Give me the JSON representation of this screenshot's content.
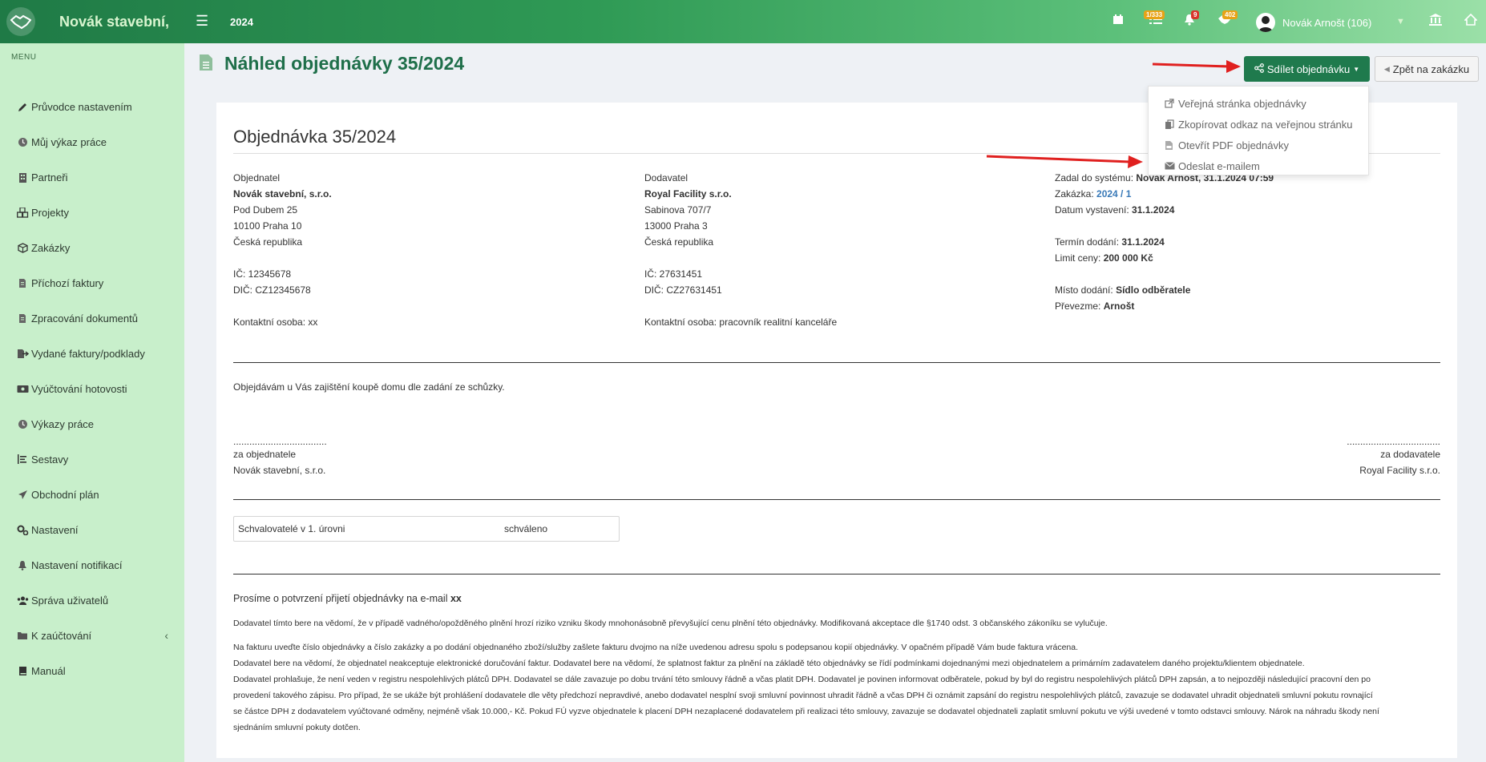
{
  "header": {
    "brand": "Novák stavební,",
    "year": "2024",
    "badges": {
      "tasks": "1/333",
      "notifications": "9",
      "messages": "402"
    },
    "user": "Novák Arnošt (106)"
  },
  "sidebar": {
    "title": "MENU",
    "items": [
      {
        "label": "Průvodce nastavením",
        "icon": "pencil-icon"
      },
      {
        "label": "Můj výkaz práce",
        "icon": "clock-icon"
      },
      {
        "label": "Partneři",
        "icon": "building-icon"
      },
      {
        "label": "Projekty",
        "icon": "cubes-icon"
      },
      {
        "label": "Zakázky",
        "icon": "cube-icon"
      },
      {
        "label": "Příchozí faktury",
        "icon": "file-icon"
      },
      {
        "label": "Zpracování dokumentů",
        "icon": "file-icon"
      },
      {
        "label": "Vydané faktury/podklady",
        "icon": "export-icon"
      },
      {
        "label": "Vyúčtování hotovosti",
        "icon": "money-icon"
      },
      {
        "label": "Výkazy práce",
        "icon": "clock-icon"
      },
      {
        "label": "Sestavy",
        "icon": "list-icon"
      },
      {
        "label": "Obchodní plán",
        "icon": "send-icon"
      },
      {
        "label": "Nastavení",
        "icon": "cogs-icon"
      },
      {
        "label": "Nastavení notifikací",
        "icon": "bell-icon"
      },
      {
        "label": "Správa uživatelů",
        "icon": "users-icon"
      },
      {
        "label": "K zaúčtování",
        "icon": "folder-icon"
      },
      {
        "label": "Manuál",
        "icon": "book-icon"
      }
    ]
  },
  "page": {
    "title": "Náhled objednávky 35/2024",
    "share_label": "Sdílet objednávku",
    "back_label": "Zpět na zakázku",
    "dropdown": [
      "Veřejná stránka objednávky",
      "Zkopírovat odkaz na veřejnou stránku",
      "Otevřít PDF objednávky",
      "Odeslat e-mailem"
    ]
  },
  "order": {
    "title": "Objednávka 35/2024",
    "buyer": {
      "heading": "Objednatel",
      "name": "Novák stavební, s.r.o.",
      "street": "Pod Dubem 25",
      "city": "10100 Praha 10",
      "country": "Česká republika",
      "ico": "IČ: 12345678",
      "dic": "DIČ: CZ12345678",
      "contact": "Kontaktní osoba: xx"
    },
    "supplier": {
      "heading": "Dodavatel",
      "name": "Royal Facility s.r.o.",
      "street": "Sabinova 707/7",
      "city": "13000 Praha 3",
      "country": "Česká republika",
      "ico": "IČ: 27631451",
      "dic": "DIČ: CZ27631451",
      "contact": "Kontaktní osoba: pracovník realitní kanceláře"
    },
    "meta": {
      "entered_label": "Zadal do systému:",
      "entered_value": "Novák Arnošt, 31.1.2024 07:59",
      "contract_label": "Zakázka:",
      "contract_value": "2024 / 1",
      "issued_label": "Datum vystavení:",
      "issued_value": "31.1.2024",
      "delivery_label": "Termín dodání:",
      "delivery_value": "31.1.2024",
      "limit_label": "Limit ceny:",
      "limit_value": "200 000 Kč",
      "place_label": "Místo dodání:",
      "place_value": "Sídlo odběratele",
      "receiver_label": "Převezme:",
      "receiver_value": "Arnošt"
    },
    "description": "Objejdávám u Vás zajištění koupě domu dle zadání ze schůzky.",
    "sign_dots": "...................................",
    "sign_buyer_label": "za objednatele",
    "sign_buyer_name": "Novák stavební, s.r.o.",
    "sign_supplier_label": "za dodavatele",
    "sign_supplier_name": "Royal Facility s.r.o.",
    "approval_label": "Schvalovatelé v 1. úrovni",
    "approval_status": "schváleno",
    "confirm_text": "Prosíme o potvrzení přijetí objednávky na e-mail",
    "confirm_email": "xx",
    "terms_1": "Dodavatel tímto bere na vědomí, že v případě vadného/opožděného plnění hrozí riziko vzniku škody mnohonásobně převyšující cenu plnění této objednávky. Modifikovaná akceptace dle §1740 odst. 3 občanského zákoníku se vylučuje.",
    "terms_2": "Na fakturu uveďte číslo objednávky a číslo zakázky a po dodání objednaného zboží/služby zašlete fakturu dvojmo na níže uvedenou adresu spolu s podepsanou kopií objednávky. V opačném případě Vám bude faktura vrácena.",
    "terms_3": "Dodavatel bere na vědomí, že objednatel neakceptuje elektronické doručování faktur. Dodavatel bere na vědomí, že splatnost faktur za plnění na základě této objednávky se řídí podmínkami dojednanými mezi objednatelem a primárním zadavatelem daného projektu/klientem objednatele.",
    "terms_4a": "Dodavatel prohlašuje, že není veden v registru nespolehlivých plátců DPH. Dodavatel se dále zavazuje po dobu trvání této smlouvy řádně a včas platit DPH. Dodavatel je povinen informovat odběratele, pokud by byl do registru nespolehlivých plátců DPH zapsán, a to nejpozději následující pracovní den po",
    "terms_4b": "provedení takového zápisu. Pro případ, že se ukáže být prohlášení dodavatele dle věty předchozí nepravdivé, anebo dodavatel nesplní svoji smluvní povinnost uhradit řádně a včas DPH či oznámit zapsání do registru nespolehlivých plátců, zavazuje se dodavatel uhradit objednateli smluvní pokutu rovnající",
    "terms_4c": "se částce DPH z dodavatelem vyúčtované odměny, nejméně však 10.000,- Kč. Pokud FÚ vyzve objednatele k placení DPH nezaplacené dodavatelem při realizaci této smlouvy, zavazuje se dodavatel objednateli zaplatit smluvní pokutu ve výši uvedené v tomto odstavci smlouvy. Nárok na náhradu škody není",
    "terms_4d": "sjednáním smluvní pokuty dotčen."
  },
  "colors": {
    "brand_green": "#1f7a4d",
    "sidebar_bg": "#c8efcb",
    "link": "#3a7ab8",
    "annotation_arrow": "#e0201f"
  }
}
